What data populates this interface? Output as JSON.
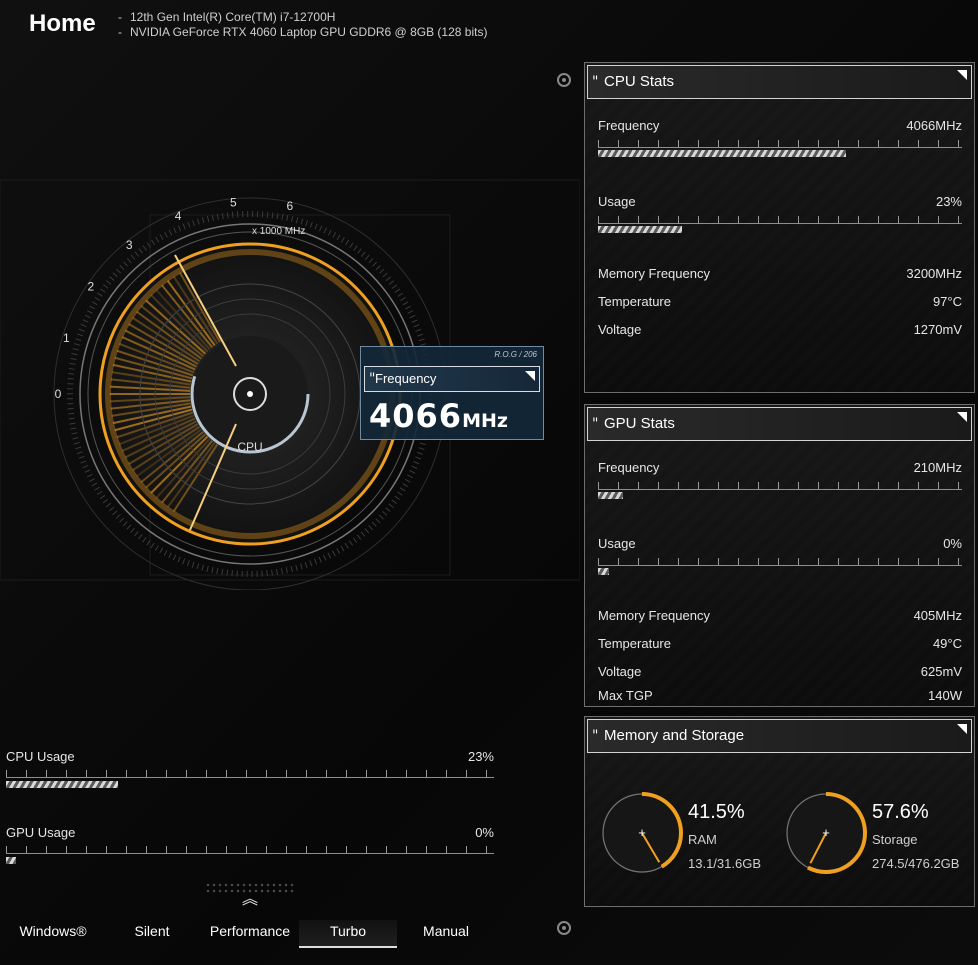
{
  "header": {
    "title": "Home",
    "cpu_name": "12th Gen Intel(R) Core(TM) i7-12700H",
    "gpu_name": "NVIDIA GeForce RTX 4060 Laptop GPU GDDR6 @ 8GB (128 bits)"
  },
  "gauge": {
    "label": "CPU",
    "unit_label": "x 1000 MHz",
    "scale": [
      "0",
      "1",
      "2",
      "3",
      "4",
      "5",
      "6"
    ],
    "frequency_panel": {
      "model_tag": "R.O.G / 206",
      "title": "Frequency",
      "value": "4066",
      "unit": "MHz"
    },
    "level_fraction": 0.678
  },
  "usage": {
    "cpu": {
      "label": "CPU Usage",
      "value": "23%",
      "fraction": 0.23
    },
    "gpu": {
      "label": "GPU Usage",
      "value": "0%",
      "fraction": 0.02
    }
  },
  "modes": {
    "items": [
      "Windows®",
      "Silent",
      "Performance",
      "Turbo",
      "Manual"
    ],
    "active": "Turbo"
  },
  "cpu_stats": {
    "title": "CPU Stats",
    "frequency": {
      "label": "Frequency",
      "value": "4066MHz",
      "fraction": 0.68
    },
    "usage": {
      "label": "Usage",
      "value": "23%",
      "fraction": 0.23
    },
    "memory_frequency": {
      "label": "Memory Frequency",
      "value": "3200MHz"
    },
    "temperature": {
      "label": "Temperature",
      "value": "97°C"
    },
    "voltage": {
      "label": "Voltage",
      "value": "1270mV"
    }
  },
  "gpu_stats": {
    "title": "GPU Stats",
    "frequency": {
      "label": "Frequency",
      "value": "210MHz",
      "fraction": 0.07
    },
    "usage": {
      "label": "Usage",
      "value": "0%",
      "fraction": 0.03
    },
    "memory_frequency": {
      "label": "Memory Frequency",
      "value": "405MHz"
    },
    "temperature": {
      "label": "Temperature",
      "value": "49°C"
    },
    "voltage": {
      "label": "Voltage",
      "value": "625mV"
    },
    "max_tgp": {
      "label": "Max TGP",
      "value": "140W"
    }
  },
  "memory_storage": {
    "title": "Memory and Storage",
    "ram": {
      "percent": "41.5%",
      "label": "RAM",
      "detail": "13.1/31.6GB",
      "fraction": 0.415
    },
    "storage": {
      "percent": "57.6%",
      "label": "Storage",
      "detail": "274.5/476.2GB",
      "fraction": 0.576
    }
  },
  "colors": {
    "accent": "#f0a020",
    "panel_border": "#d4d4d4",
    "freq_panel_bg": "#14283a"
  }
}
